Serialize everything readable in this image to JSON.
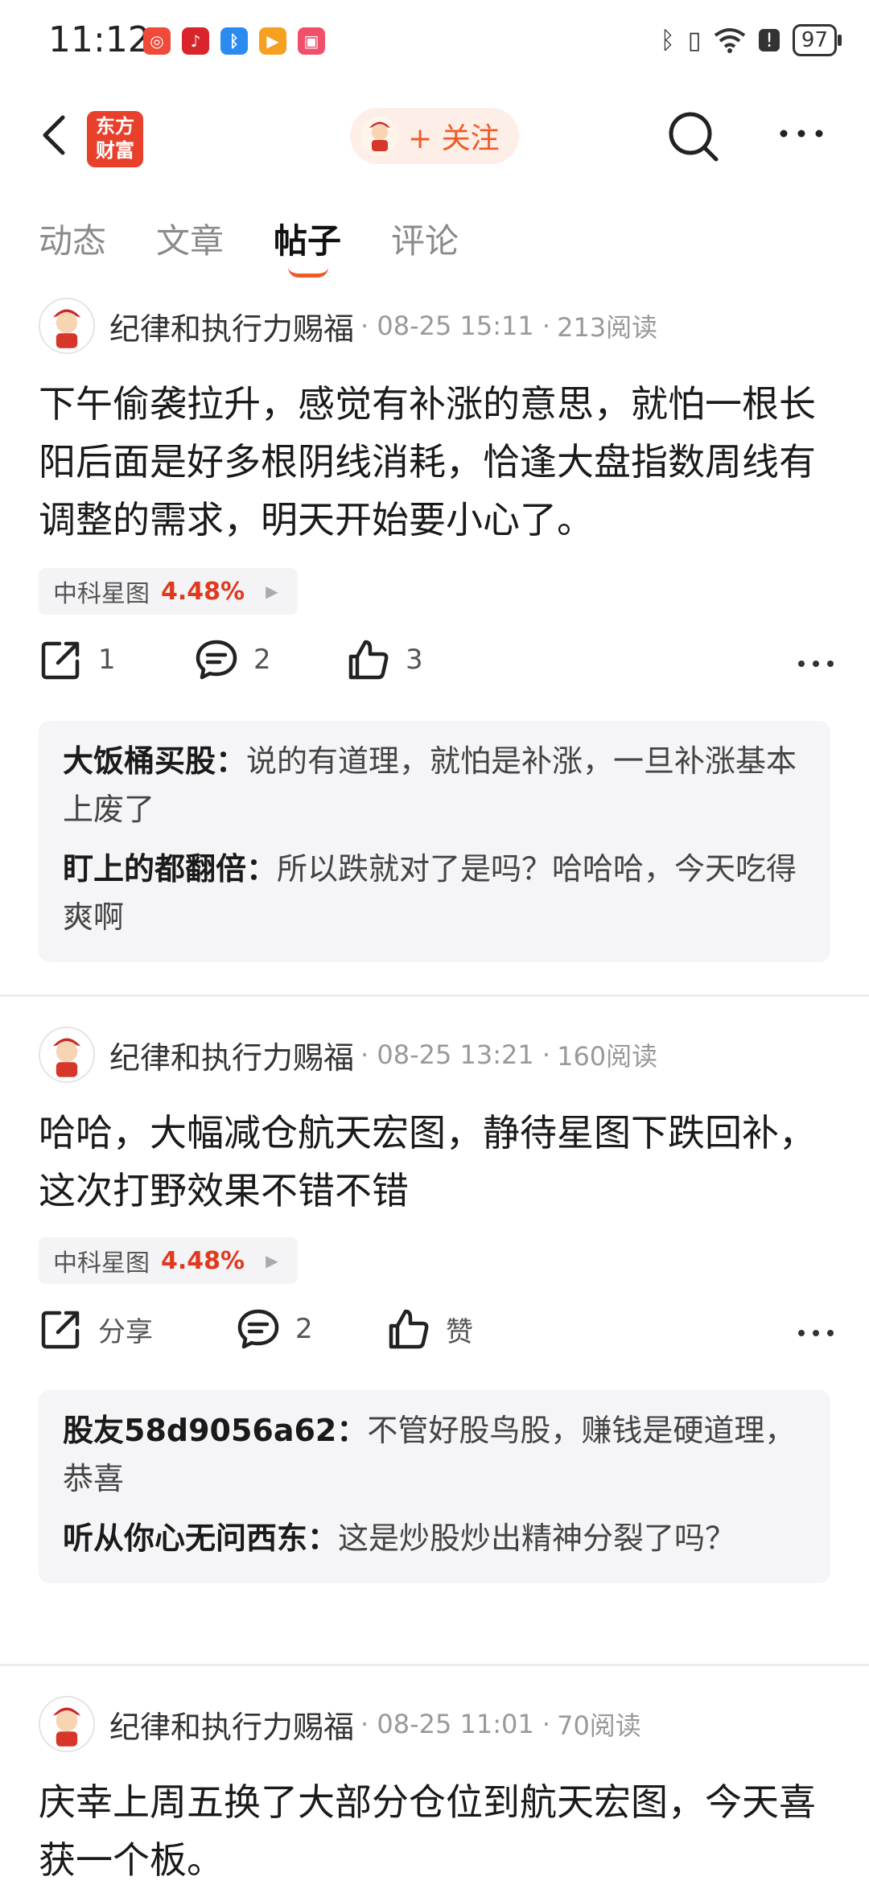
{
  "status_bar": {
    "time": "11:12",
    "battery": "97"
  },
  "header": {
    "logo_text": "东方财富",
    "follow_label": "+ 关注"
  },
  "tabs": [
    {
      "label": "动态",
      "active": false
    },
    {
      "label": "文章",
      "active": false
    },
    {
      "label": "帖子",
      "active": true
    },
    {
      "label": "评论",
      "active": false
    }
  ],
  "posts": [
    {
      "author": "纪律和执行力赐福",
      "date": "· 08-25 15:11 ·",
      "reads": "213阅读",
      "text": "下午偷袭拉升，感觉有补涨的意思，就怕一根长阳后面是好多根阴线消耗，恰逢大盘指数周线有调整的需求，明天开始要小心了。",
      "stock": {
        "name": "中科星图",
        "change": "4.48%"
      },
      "share": "1",
      "comment_count": "2",
      "like": "3",
      "comments": [
        {
          "user": "大饭桶买股",
          "sep": "：",
          "text": "说的有道理，就怕是补涨，一旦补涨基本上废了"
        },
        {
          "user": "盯上的都翻倍",
          "sep": "：",
          "text": "所以跌就对了是吗？哈哈哈，今天吃得爽啊"
        }
      ]
    },
    {
      "author": "纪律和执行力赐福",
      "date": "· 08-25 13:21 ·",
      "reads": "160阅读",
      "text": "哈哈，大幅减仓航天宏图，静待星图下跌回补，这次打野效果不错不错",
      "stock": {
        "name": "中科星图",
        "change": "4.48%"
      },
      "share": "分享",
      "comment_count": "2",
      "like": "赞",
      "comments": [
        {
          "user": "股友58d9056a62",
          "sep": "：",
          "text": "不管好股鸟股，赚钱是硬道理，恭喜"
        },
        {
          "user": "听从你心无问西东",
          "sep": "：",
          "text": "这是炒股炒出精神分裂了吗？"
        }
      ]
    },
    {
      "author": "纪律和执行力赐福",
      "date": "· 08-25 11:01 ·",
      "reads": "70阅读",
      "text": "庆幸上周五换了大部分仓位到航天宏图，今天喜获一个板。"
    }
  ],
  "colors": {
    "accent": "#f15a24",
    "stock_up": "#e03a1e",
    "logo_bg": "#e8402a"
  }
}
